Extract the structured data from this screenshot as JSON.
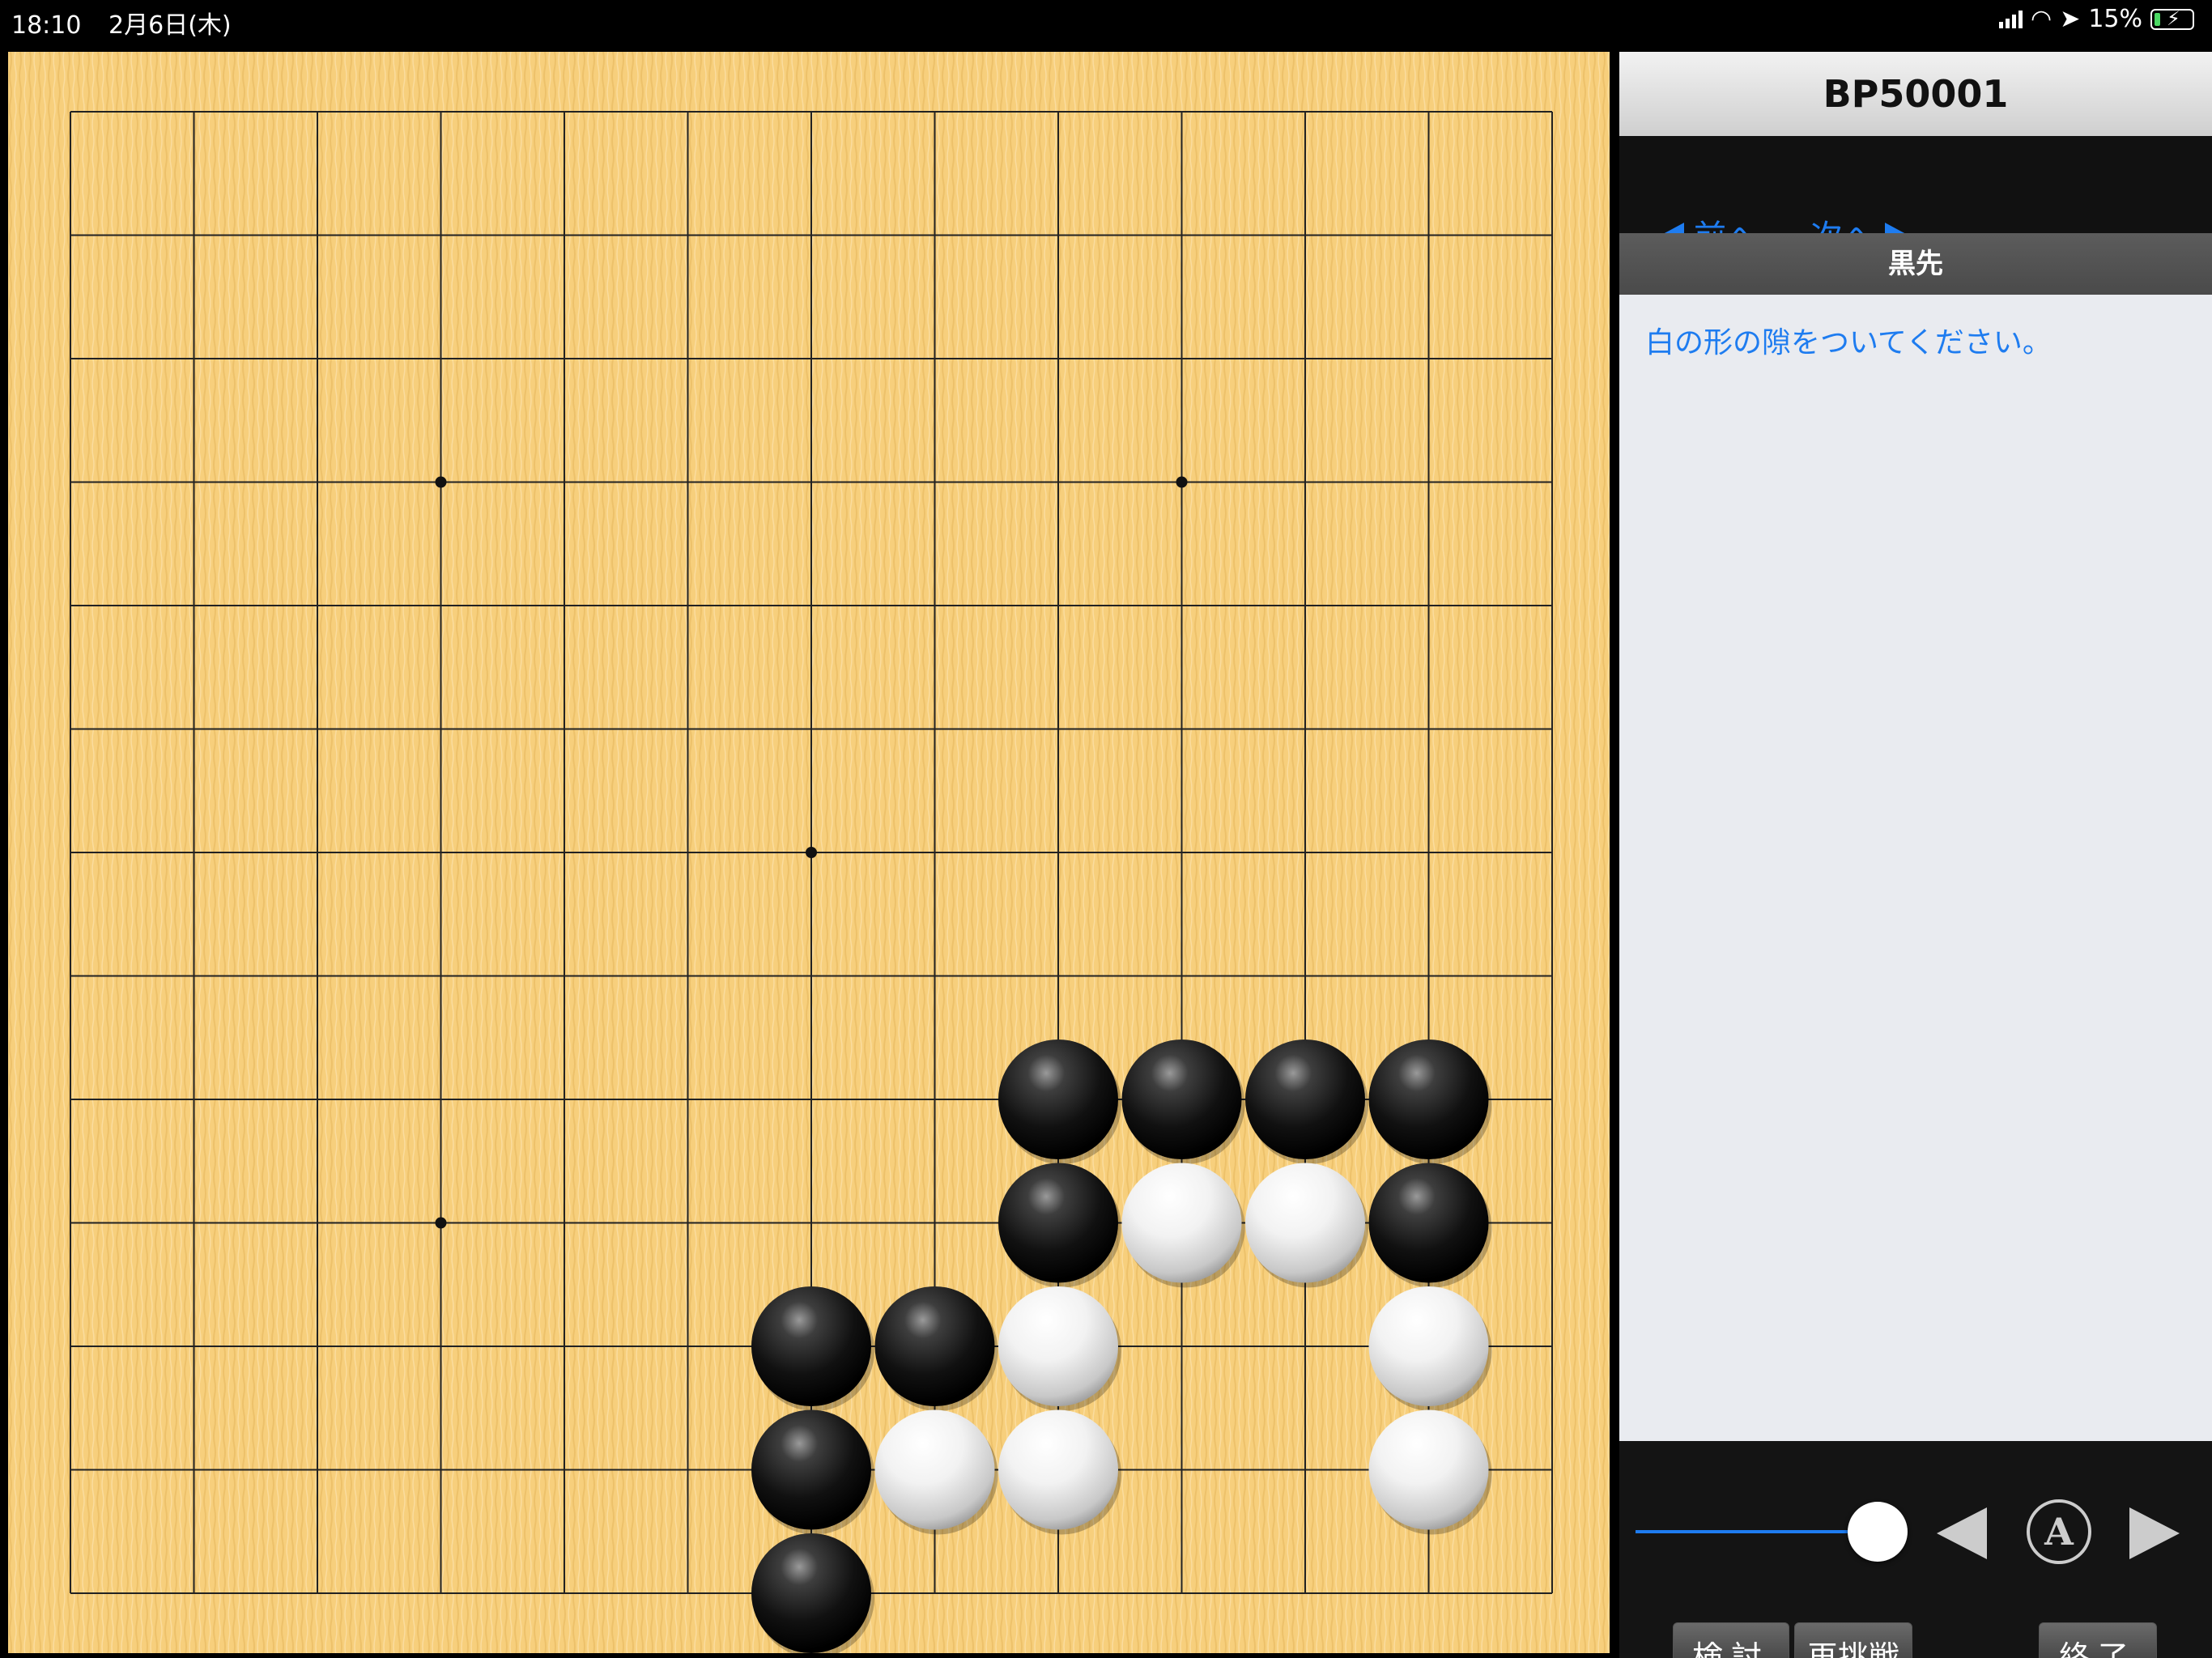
{
  "status": {
    "time": "18:10",
    "date": "2月6日(木)",
    "battery": "15%",
    "battery_level": 0.15
  },
  "board": {
    "size": 13,
    "hoshi": [
      [
        3,
        3
      ],
      [
        9,
        3
      ],
      [
        6,
        6
      ],
      [
        3,
        9
      ]
    ],
    "stones": [
      {
        "c": "b",
        "x": 8,
        "y": 8
      },
      {
        "c": "b",
        "x": 9,
        "y": 8
      },
      {
        "c": "b",
        "x": 10,
        "y": 8
      },
      {
        "c": "b",
        "x": 11,
        "y": 8
      },
      {
        "c": "b",
        "x": 8,
        "y": 9
      },
      {
        "c": "w",
        "x": 9,
        "y": 9
      },
      {
        "c": "w",
        "x": 10,
        "y": 9
      },
      {
        "c": "b",
        "x": 11,
        "y": 9
      },
      {
        "c": "b",
        "x": 6,
        "y": 10
      },
      {
        "c": "b",
        "x": 7,
        "y": 10
      },
      {
        "c": "w",
        "x": 8,
        "y": 10
      },
      {
        "c": "w",
        "x": 11,
        "y": 10
      },
      {
        "c": "b",
        "x": 6,
        "y": 11
      },
      {
        "c": "w",
        "x": 7,
        "y": 11
      },
      {
        "c": "w",
        "x": 8,
        "y": 11
      },
      {
        "c": "w",
        "x": 11,
        "y": 11
      },
      {
        "c": "b",
        "x": 6,
        "y": 12
      }
    ]
  },
  "panel": {
    "title": "BP50001",
    "nav": {
      "prev": "前へ",
      "next": "次へ"
    },
    "turn": "黒先",
    "description": "白の形の隙をついてください。"
  },
  "controls": {
    "auto_label": "A",
    "review": "検討",
    "retry": "再挑戦",
    "end": "終了",
    "slider_position": 1.0
  }
}
